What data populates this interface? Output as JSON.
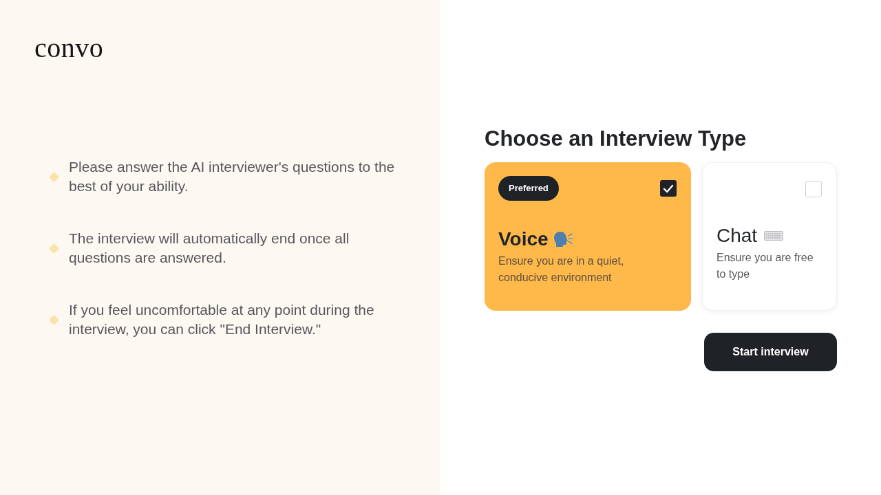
{
  "logo": {
    "text": "convo"
  },
  "instructions": [
    {
      "text": "Please answer the AI interviewer's questions to the best of your ability."
    },
    {
      "text": "The interview will automatically end once all questions are answered."
    },
    {
      "text": "If you feel uncomfortable at any point during the interview, you can click \"End Interview.\""
    }
  ],
  "interview_type": {
    "title": "Choose an Interview Type",
    "options": [
      {
        "kind": "voice",
        "title": "Voice",
        "description": "Ensure you are in a quiet, conducive environment",
        "badge": "Preferred",
        "selected": true
      },
      {
        "kind": "chat",
        "title": "Chat",
        "description": "Ensure you are free to type",
        "selected": false
      }
    ]
  },
  "start_button": {
    "label": "Start interview"
  }
}
